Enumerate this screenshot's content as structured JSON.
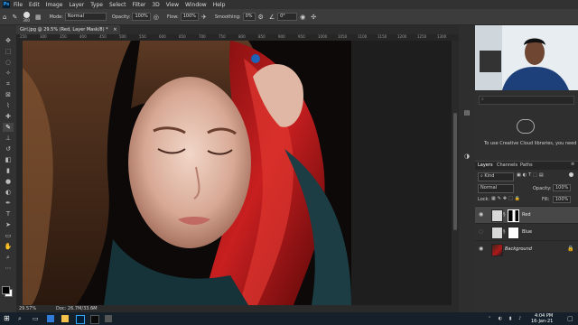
{
  "menubar": {
    "app_logo": "Ps",
    "items": [
      "File",
      "Edit",
      "Image",
      "Layer",
      "Type",
      "Select",
      "Filter",
      "3D",
      "View",
      "Window",
      "Help"
    ]
  },
  "options": {
    "brush_size": "300",
    "mode_label": "Mode:",
    "mode_value": "Normal",
    "opacity_label": "Opacity:",
    "opacity_value": "100%",
    "flow_label": "Flow:",
    "flow_value": "100%",
    "smoothing_label": "Smoothing:",
    "smoothing_value": "0%",
    "angle_value": "0°"
  },
  "document": {
    "tab_title": "Girl.jpg @ 29.5% (Red, Layer Mask/8) *",
    "ruler_ticks": [
      "250",
      "300",
      "350",
      "400",
      "450",
      "500",
      "550",
      "600",
      "650",
      "700",
      "750",
      "800",
      "850",
      "900",
      "950",
      "1000",
      "1050",
      "1100",
      "1150",
      "1200",
      "1250",
      "1300"
    ],
    "zoom": "29.57%",
    "doc_info": "Doc: 26.7M/33.6M"
  },
  "libraries": {
    "message": "To use Creative Cloud libraries, you need"
  },
  "layers_panel": {
    "tabs": [
      "Layers",
      "Channels",
      "Paths"
    ],
    "kind_label": "Kind",
    "blend_mode": "Normal",
    "opacity_label": "Opacity:",
    "opacity_value": "100%",
    "lock_label": "Lock:",
    "fill_label": "Fill:",
    "fill_value": "100%",
    "layers": [
      {
        "name": "Red",
        "selected": true
      },
      {
        "name": "Blue",
        "selected": false
      },
      {
        "name": "Background",
        "selected": false
      }
    ]
  },
  "taskbar": {
    "time": "4:04 PM",
    "date": "16-Jan-21"
  },
  "colors": {
    "accent": "#31a8ff",
    "hair_red": "#b0191a",
    "panel_bg": "#2f2f2f"
  }
}
